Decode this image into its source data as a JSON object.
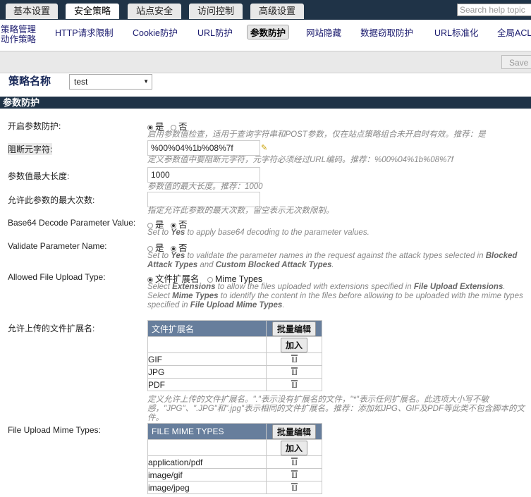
{
  "tabs": [
    {
      "label": "基本设置",
      "active": false
    },
    {
      "label": "安全策略",
      "active": true
    },
    {
      "label": "站点安全",
      "active": false
    },
    {
      "label": "访问控制",
      "active": false
    },
    {
      "label": "高级设置",
      "active": false
    }
  ],
  "search": {
    "placeholder": "Search help topic"
  },
  "subnav": {
    "item0_line1": "策略管理",
    "item0_line2": "动作策略",
    "item1": "HTTP请求限制",
    "item2": "Cookie防护",
    "item3": "URL防护",
    "item4": "参数防护",
    "item5": "网站隐藏",
    "item6": "数据窃取防护",
    "item7": "URL标准化",
    "item8": "全局ACL"
  },
  "toolbar": {
    "save": "Save"
  },
  "policy": {
    "label": "策略名称",
    "value": "test"
  },
  "section": {
    "title": "参数防护"
  },
  "fields": {
    "enable": {
      "label": "开启参数防护:",
      "opt_yes": "是",
      "opt_no": "否",
      "hint": "启用参数值检查，适用于查询字符串和POST参数，仅在站点策略组合未开启时有效。推荐：是"
    },
    "block_chars": {
      "label": "阻断元字符:",
      "value": "%00%04%1b%08%7f",
      "hint": "定义参数值中要阻断元字符，元字符必须经过URL编码。推荐：%00%04%1b%08%7f"
    },
    "max_len": {
      "label": "参数值最大长度:",
      "value": "1000",
      "hint": "参数值的最大长度。推荐：1000"
    },
    "max_count": {
      "label": "允许此参数的最大次数:",
      "value": "",
      "hint": "指定允许此参数的最大次数，留空表示无次数限制。"
    },
    "base64": {
      "label": "Base64 Decode Parameter Value:",
      "opt_yes": "是",
      "opt_no": "否",
      "hint_1": "Set to ",
      "hint_2": "Yes",
      "hint_3": " to apply base64 decoding to the parameter values."
    },
    "validate": {
      "label": "Validate Parameter Name:",
      "opt_yes": "是",
      "opt_no": "否",
      "hint_1": "Set to ",
      "hint_2": "Yes",
      "hint_3": " to validate the parameter names in the request against the attack types selected in ",
      "hint_4": "Blocked Attack Types",
      "hint_5": " and ",
      "hint_6": "Custom Blocked Attack Types",
      "hint_7": "."
    },
    "upload_type": {
      "label": "Allowed File Upload Type:",
      "opt_ext": "文件扩展名",
      "opt_mime": "Mime Types",
      "hint_a1": "Select ",
      "hint_a2": "Extensions",
      "hint_a3": " to allow the files uploaded with extensions specified in ",
      "hint_a4": "File Upload Extensions",
      "hint_a5": ".",
      "hint_b1": "Select ",
      "hint_b2": "Mime Types",
      "hint_b3": " to identify the content in the files before allowing to be uploaded with the mime types specified in ",
      "hint_b4": "File Upload Mime Types",
      "hint_b5": "."
    },
    "ext_table": {
      "label": "允许上传的文件扩展名:",
      "header": "文件扩展名",
      "batch": "批量编辑",
      "add": "加入",
      "rows": [
        "GIF",
        "JPG",
        "PDF"
      ],
      "hint": "定义允许上传的文件扩展名。\".\"表示没有扩展名的文件，\"*\"表示任何扩展名。此选项大小写不敏感，\"JPG\"、\".JPG\"和\".jpg\"表示相同的文件扩展名。推荐：添加如JPG、GIF及PDF等此类不包含脚本的文件。"
    },
    "mime_table": {
      "label": "File Upload Mime Types:",
      "header": "FILE MIME TYPES",
      "batch": "批量编辑",
      "add": "加入",
      "rows": [
        "application/pdf",
        "image/gif",
        "image/jpeg"
      ]
    }
  }
}
